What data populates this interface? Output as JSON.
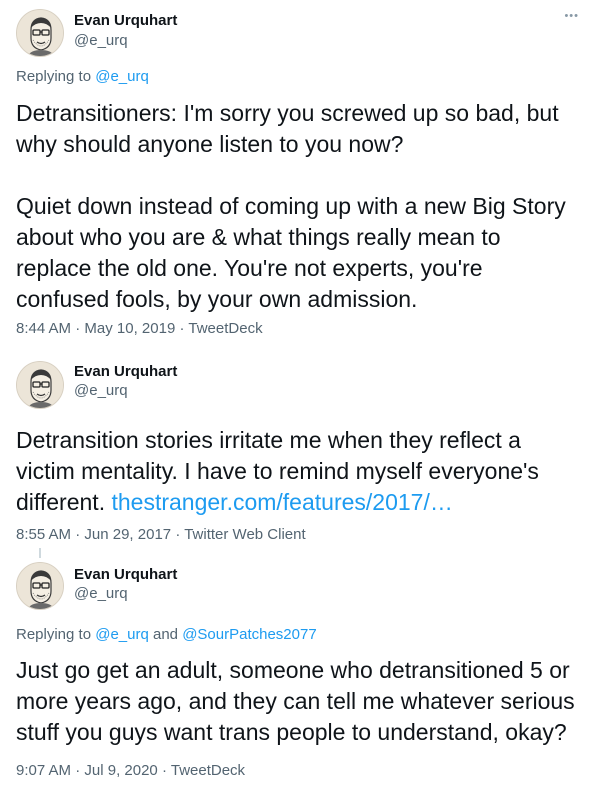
{
  "tweets": [
    {
      "name": "Evan Urquhart",
      "handle": "@e_urq",
      "more_label": "•••",
      "replying_prefix": "Replying to",
      "replying_to": [
        "@e_urq"
      ],
      "paragraphs": [
        "Detransitioners: I'm sorry you screwed up so bad, but why should anyone listen to you now?",
        "Quiet down instead of coming up with a new Big Story about who you are & what things really mean to replace the old one. You're not experts, you're confused fools, by your own admission."
      ],
      "time": "8:44 AM",
      "date": "May 10, 2019",
      "source": "TweetDeck"
    },
    {
      "name": "Evan Urquhart",
      "handle": "@e_urq",
      "text": "Detransition stories irritate me when they reflect a victim mentality. I have to remind myself everyone's different.",
      "link": "thestranger.com/features/2017/…",
      "time": "8:55 AM",
      "date": "Jun 29, 2017",
      "source": "Twitter Web Client"
    },
    {
      "name": "Evan Urquhart",
      "handle": "@e_urq",
      "replying_prefix": "Replying to",
      "replying_to": [
        "@e_urq",
        "@SourPatches2077"
      ],
      "replying_joiner": "and",
      "text": "Just go get an adult, someone who detransitioned 5 or more years ago, and they can tell me whatever serious stuff you guys want trans people to understand, okay?",
      "time": "9:07 AM",
      "date": "Jul 9, 2020",
      "source": "TweetDeck"
    }
  ],
  "separator": "·",
  "colors": {
    "text": "#0f1419",
    "secondary": "#536471",
    "link": "#1d9bf0"
  },
  "icons": [
    "avatar-sketch-icon",
    "more-options-icon"
  ]
}
